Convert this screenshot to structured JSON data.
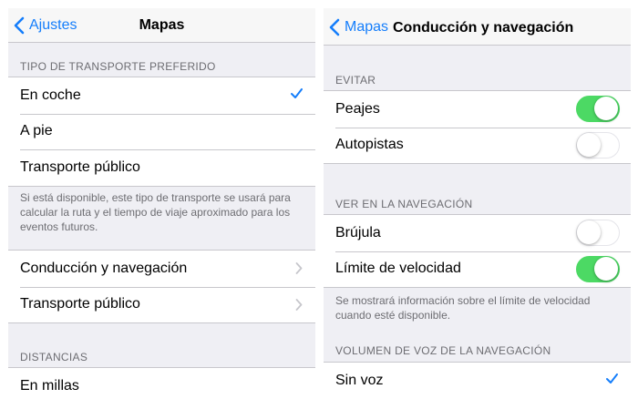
{
  "left_panel": {
    "nav": {
      "back_label": "Ajustes",
      "title": "Mapas"
    },
    "transport_section": {
      "header": "TIPO DE TRANSPORTE PREFERIDO",
      "items": [
        {
          "label": "En coche",
          "selected": true
        },
        {
          "label": "A pie",
          "selected": false
        },
        {
          "label": "Transporte público",
          "selected": false
        }
      ],
      "footer": "Si está disponible, este tipo de transporte se usará para calcular la ruta y el tiempo de viaje aproximado para los eventos futuros."
    },
    "links_section": {
      "items": [
        {
          "label": "Conducción y navegación"
        },
        {
          "label": "Transporte público"
        }
      ]
    },
    "distances_section": {
      "header": "DISTANCIAS",
      "items": [
        {
          "label": "En millas"
        }
      ]
    }
  },
  "right_panel": {
    "nav": {
      "back_label": "Mapas",
      "title": "Conducción y navegación"
    },
    "avoid_section": {
      "header": "EVITAR",
      "items": [
        {
          "label": "Peajes",
          "on": true
        },
        {
          "label": "Autopistas",
          "on": false
        }
      ]
    },
    "navigation_section": {
      "header": "VER EN LA NAVEGACIÓN",
      "items": [
        {
          "label": "Brújula",
          "on": false
        },
        {
          "label": "Límite de velocidad",
          "on": true
        }
      ],
      "footer": "Se mostrará información sobre el límite de velocidad cuando esté disponible."
    },
    "voice_section": {
      "header": "VOLUMEN DE VOZ DE LA NAVEGACIÓN",
      "items": [
        {
          "label": "Sin voz",
          "selected": true
        }
      ]
    }
  },
  "colors": {
    "accent": "#157efb",
    "toggle_on": "#4cd964",
    "group_background": "#efeff4",
    "separator": "#c8c7cc",
    "secondary_text": "#6d6d72"
  },
  "icons": {
    "back": "chevron-left-icon",
    "checkmark": "checkmark-icon",
    "disclosure": "chevron-right-icon"
  }
}
